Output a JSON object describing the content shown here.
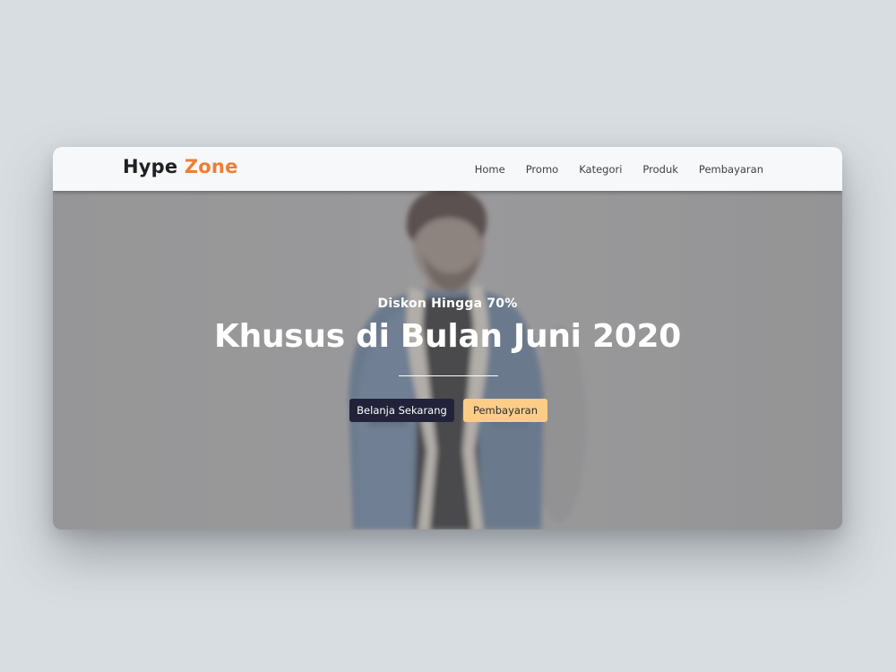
{
  "brand": {
    "name_part1": "Hype",
    "name_part2": "Zone",
    "accent_color": "#f07d35"
  },
  "nav": {
    "items": [
      {
        "label": "Home"
      },
      {
        "label": "Promo"
      },
      {
        "label": "Kategori"
      },
      {
        "label": "Produk"
      },
      {
        "label": "Pembayaran"
      }
    ]
  },
  "hero": {
    "subtitle": "Diskon Hingga 70%",
    "title": "Khusus di Bulan Juni 2020",
    "primary_button": "Belanja Sekarang",
    "secondary_button": "Pembayaran",
    "primary_color": "#22223a",
    "secondary_color": "#fccd86"
  }
}
